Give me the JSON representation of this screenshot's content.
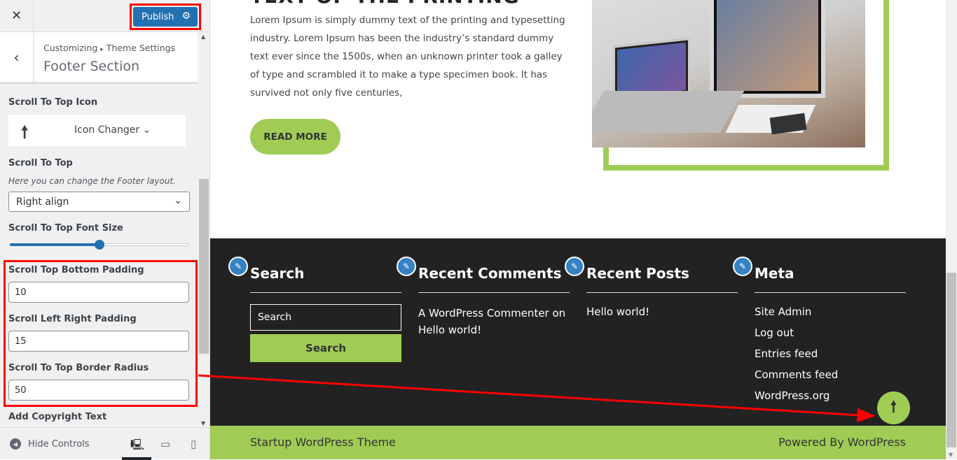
{
  "customizer": {
    "close_icon": "close-icon",
    "publish_label": "Publish",
    "breadcrumb": {
      "root": "Customizing",
      "separator": "▸",
      "section": "Theme Settings"
    },
    "section_title": "Footer Section",
    "scroll_top_icon": {
      "label": "Scroll To Top Icon",
      "value_icon": "arrow-up",
      "changer_label": "Icon Changer"
    },
    "scroll_top": {
      "label": "Scroll To Top",
      "description": "Here you can change the Footer layout.",
      "selected": "Right align"
    },
    "font_size": {
      "label": "Scroll To Top Font Size",
      "slider_percent": 50
    },
    "bottom_padding": {
      "label": "Scroll Top Bottom Padding",
      "value": "10"
    },
    "lr_padding": {
      "label": "Scroll Left Right Padding",
      "value": "15"
    },
    "border_radius": {
      "label": "Scroll To Top Border Radius",
      "value": "50"
    },
    "copyright": {
      "label": "Add Copyright Text"
    },
    "hide_controls": "Hide Controls",
    "devices": [
      "desktop",
      "tablet",
      "mobile"
    ]
  },
  "preview": {
    "heading": "TEXT OF THE PRINTING",
    "paragraph": "Lorem Ipsum is simply dummy text of the printing and typesetting industry. Lorem Ipsum has been the industry’s standard dummy text ever since the 1500s, when an unknown printer took a galley of type and scrambled it to make a type specimen book. It has survived not only five centuries,",
    "read_more": "READ MORE",
    "footer": {
      "search": {
        "title": "Search",
        "placeholder": "Search",
        "button": "Search"
      },
      "recent_comments": {
        "title": "Recent Comments",
        "items": [
          "A WordPress Commenter on Hello world!"
        ]
      },
      "recent_posts": {
        "title": "Recent Posts",
        "items": [
          "Hello world!"
        ]
      },
      "meta": {
        "title": "Meta",
        "items": [
          "Site Admin",
          "Log out",
          "Entries feed",
          "Comments feed",
          "WordPress.org"
        ]
      }
    },
    "copyright_left": "Startup WordPress Theme",
    "copyright_right": "Powered By WordPress"
  },
  "colors": {
    "accent": "#a0cc55",
    "publish": "#2271b1",
    "footer_bg": "#222222",
    "annotation": "#ff0000"
  }
}
